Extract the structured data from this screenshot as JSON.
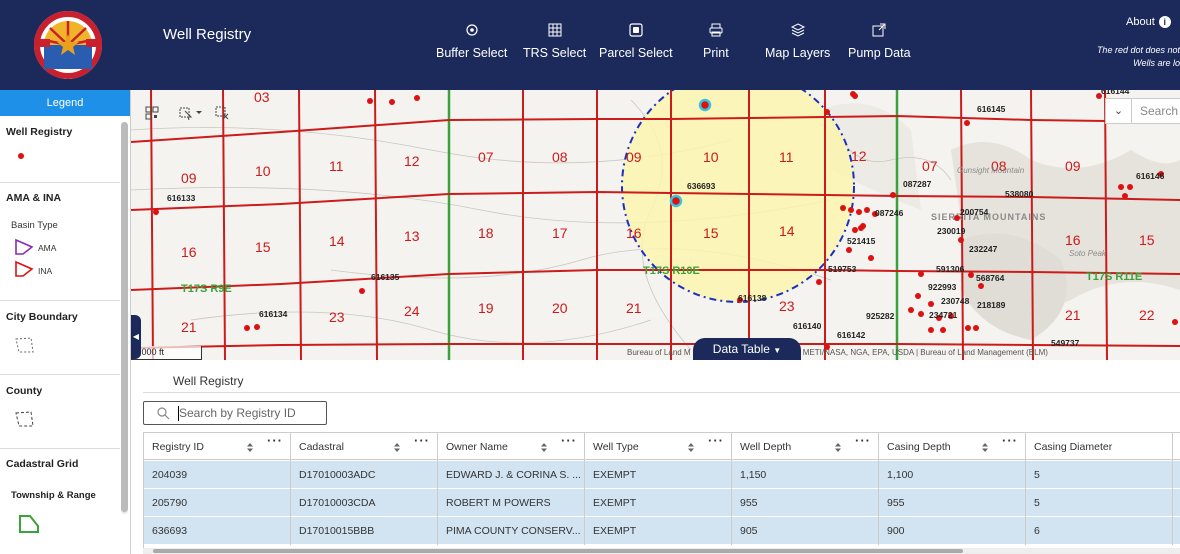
{
  "header": {
    "title": "Well Registry",
    "toolbar": [
      {
        "label": "Buffer Select",
        "icon": "target-icon"
      },
      {
        "label": "TRS Select",
        "icon": "grid-icon"
      },
      {
        "label": "Parcel Select",
        "icon": "parcel-icon"
      },
      {
        "label": "Print",
        "icon": "print-icon"
      },
      {
        "label": "Map Layers",
        "icon": "layers-icon"
      },
      {
        "label": "Pump Data",
        "icon": "external-link-icon"
      }
    ],
    "about": "About",
    "notice_line1": "The red dot does not",
    "notice_line2": "Wells are lo"
  },
  "legend": {
    "tab": "Legend",
    "sections": {
      "well_registry": "Well Registry",
      "ama_ina": "AMA & INA",
      "basin_type": "Basin Type",
      "ama": "AMA",
      "ina": "INA",
      "city_boundary": "City Boundary",
      "county": "County",
      "cadastral_grid": "Cadastral Grid",
      "township_range": "Township & Range"
    }
  },
  "map": {
    "search_placeholder": "Search",
    "scale": "5,000 ft",
    "attribution": "Bureau of Land M                                       armin, INCREMENT P, USGS, METI/NASA, NGA, EPA, USDA | Bureau of Land Management (BLM)",
    "data_table_label": "Data Table",
    "sections": [
      {
        "n": "03"
      },
      {
        "n": "09"
      },
      {
        "n": "10"
      },
      {
        "n": "11"
      },
      {
        "n": "12"
      },
      {
        "n": "07"
      },
      {
        "n": "08"
      },
      {
        "n": "09"
      },
      {
        "n": "10"
      },
      {
        "n": "11"
      },
      {
        "n": "12"
      },
      {
        "n": "07"
      },
      {
        "n": "08"
      },
      {
        "n": "09"
      },
      {
        "n": "16"
      },
      {
        "n": "15"
      },
      {
        "n": "14"
      },
      {
        "n": "13"
      },
      {
        "n": "18"
      },
      {
        "n": "17"
      },
      {
        "n": "16"
      },
      {
        "n": "15"
      },
      {
        "n": "14"
      },
      {
        "n": "16"
      },
      {
        "n": "15"
      },
      {
        "n": "21"
      },
      {
        "n": "23"
      },
      {
        "n": "24"
      },
      {
        "n": "19"
      },
      {
        "n": "20"
      },
      {
        "n": "21"
      },
      {
        "n": "23"
      },
      {
        "n": "21"
      },
      {
        "n": "22"
      }
    ],
    "well_ids": [
      "616133",
      "616134",
      "616135",
      "636693",
      "616138",
      "616140",
      "616142",
      "616145",
      "087287",
      "087246",
      "521415",
      "519753",
      "925282",
      "549737",
      "230019",
      "232247",
      "591306",
      "568764",
      "922993",
      "230748",
      "218189",
      "234721",
      "200754",
      "538080",
      "616146",
      "616144"
    ],
    "township_labels": [
      "T17S R9E",
      "T17S R10E",
      "T17S R11E"
    ],
    "place_labels": [
      "SIERRITA MOUNTAINS",
      "Gunsight Mountain",
      "Soto Peak"
    ]
  },
  "table": {
    "title": "Well Registry",
    "search_placeholder": "Search by Registry ID",
    "columns": [
      "Registry ID",
      "Cadastral",
      "Owner Name",
      "Well Type",
      "Well Depth",
      "Casing Depth",
      "Casing Diameter"
    ],
    "rows": [
      [
        "204039",
        "D17010003ADC",
        "EDWARD J. & CORINA S. ...",
        "EXEMPT",
        "1,150",
        "1,100",
        "5"
      ],
      [
        "205790",
        "D17010003CDA",
        "ROBERT M POWERS",
        "EXEMPT",
        "955",
        "955",
        "5"
      ],
      [
        "636693",
        "D17010015BBB",
        "PIMA COUNTY CONSERV...",
        "EXEMPT",
        "905",
        "900",
        "6"
      ]
    ]
  },
  "colors": {
    "header_bg": "#1b2a5a",
    "legend_tab": "#1e90e8",
    "grid_red": "#cc1b1b",
    "township_green": "#3aa23a",
    "buffer_fill": "#fbf5b0",
    "buffer_stroke": "#1a2fbf",
    "row_selected": "#d2e4f2"
  }
}
